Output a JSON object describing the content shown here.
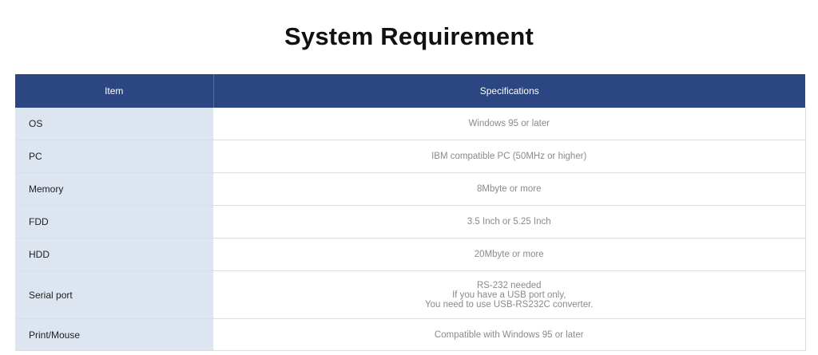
{
  "title": "System Requirement",
  "table": {
    "headers": {
      "item": "Item",
      "specifications": "Specifications"
    },
    "rows": [
      {
        "item": "OS",
        "spec": [
          "Windows 95 or later"
        ]
      },
      {
        "item": "PC",
        "spec": [
          "IBM compatible PC (50MHz or higher)"
        ]
      },
      {
        "item": "Memory",
        "spec": [
          "8Mbyte or more"
        ]
      },
      {
        "item": "FDD",
        "spec": [
          "3.5 Inch or 5.25 Inch"
        ]
      },
      {
        "item": "HDD",
        "spec": [
          "20Mbyte or more"
        ]
      },
      {
        "item": "Serial port",
        "spec": [
          "RS-232 needed",
          "If you have a USB port only,",
          "You need to use USB-RS232C converter."
        ]
      },
      {
        "item": "Print/Mouse",
        "spec": [
          "Compatible with Windows 95 or later"
        ]
      }
    ]
  },
  "colors": {
    "header_bg": "#2b4680",
    "item_cell_bg": "#dde5f1",
    "spec_text": "#8a8a8a"
  }
}
